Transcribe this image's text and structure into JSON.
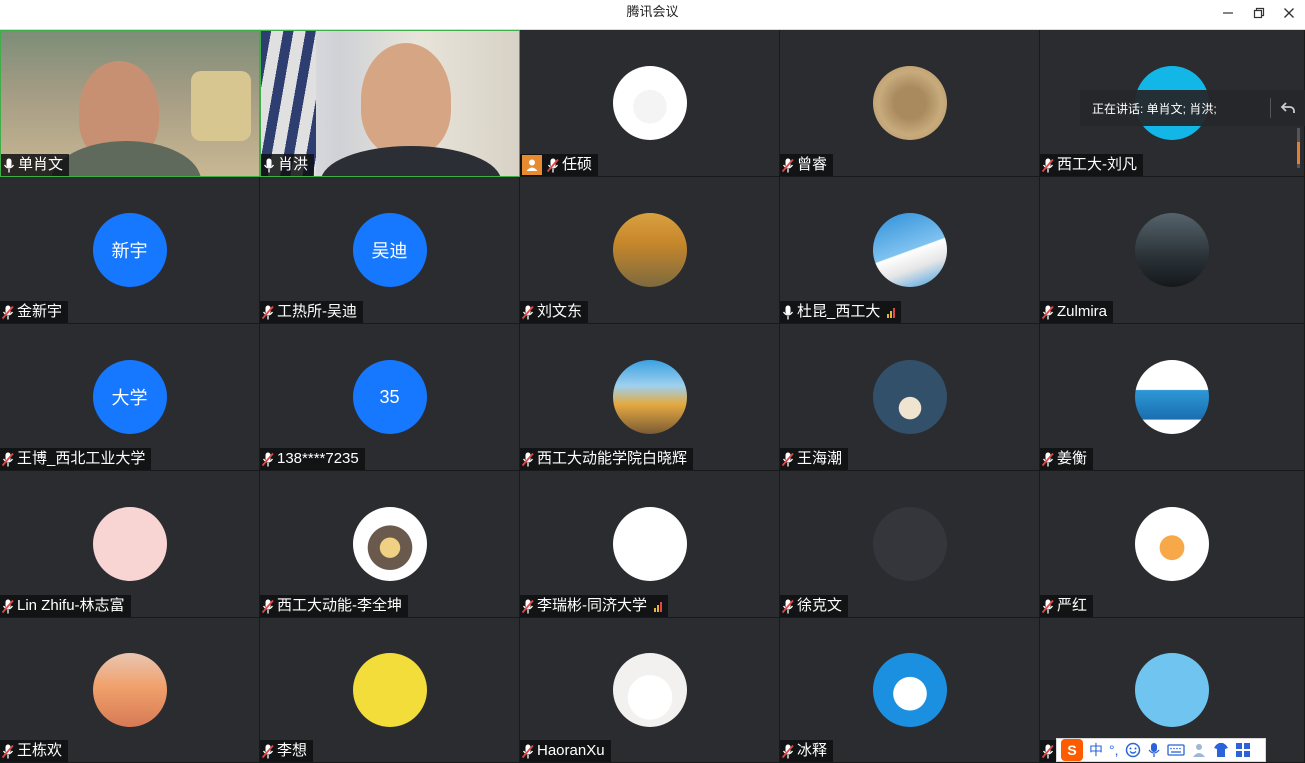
{
  "window": {
    "title": "腾讯会议"
  },
  "speaking": {
    "label": "正在讲话: 单肖文; 肖洪;"
  },
  "participants": [
    {
      "name": "单肖文",
      "mic": "on",
      "type": "video1"
    },
    {
      "name": "肖洪",
      "mic": "on",
      "type": "video2"
    },
    {
      "name": "任硕",
      "mic": "muted",
      "type": "avatar",
      "badge": "host"
    },
    {
      "name": "曾睿",
      "mic": "muted",
      "type": "avatar"
    },
    {
      "name": "西工大-刘凡",
      "mic": "muted",
      "type": "avatar"
    },
    {
      "name": "金新宇",
      "mic": "muted",
      "type": "initials",
      "initials": "新宇"
    },
    {
      "name": "工热所-吴迪",
      "mic": "muted",
      "type": "initials",
      "initials": "吴迪"
    },
    {
      "name": "刘文东",
      "mic": "muted",
      "type": "avatar"
    },
    {
      "name": "杜昆_西工大",
      "mic": "on",
      "type": "avatar",
      "signal": true
    },
    {
      "name": "Zulmira",
      "mic": "muted",
      "type": "avatar"
    },
    {
      "name": "王博_西北工业大学",
      "mic": "muted",
      "type": "initials",
      "initials": "大学"
    },
    {
      "name": "138****7235",
      "mic": "muted",
      "type": "initials",
      "initials": "35"
    },
    {
      "name": "西工大动能学院白晓辉",
      "mic": "muted",
      "type": "avatar"
    },
    {
      "name": "王海潮",
      "mic": "muted",
      "type": "avatar"
    },
    {
      "name": "姜衡",
      "mic": "muted",
      "type": "avatar"
    },
    {
      "name": "Lin Zhifu-林志富",
      "mic": "muted",
      "type": "avatar"
    },
    {
      "name": "西工大动能-李全坤",
      "mic": "muted",
      "type": "avatar"
    },
    {
      "name": "李瑞彬-同济大学",
      "mic": "muted",
      "type": "avatar",
      "signal": true
    },
    {
      "name": "徐克文",
      "mic": "muted",
      "type": "avatar"
    },
    {
      "name": "严红",
      "mic": "muted",
      "type": "avatar"
    },
    {
      "name": "王栋欢",
      "mic": "muted",
      "type": "avatar"
    },
    {
      "name": "李想",
      "mic": "muted",
      "type": "avatar"
    },
    {
      "name": "HaoranXu",
      "mic": "muted",
      "type": "avatar"
    },
    {
      "name": "冰释",
      "mic": "muted",
      "type": "avatar"
    },
    {
      "name": "",
      "mic": "muted",
      "type": "avatar"
    }
  ],
  "ime": {
    "logo": "S",
    "mode": "中",
    "punct": "°,"
  }
}
